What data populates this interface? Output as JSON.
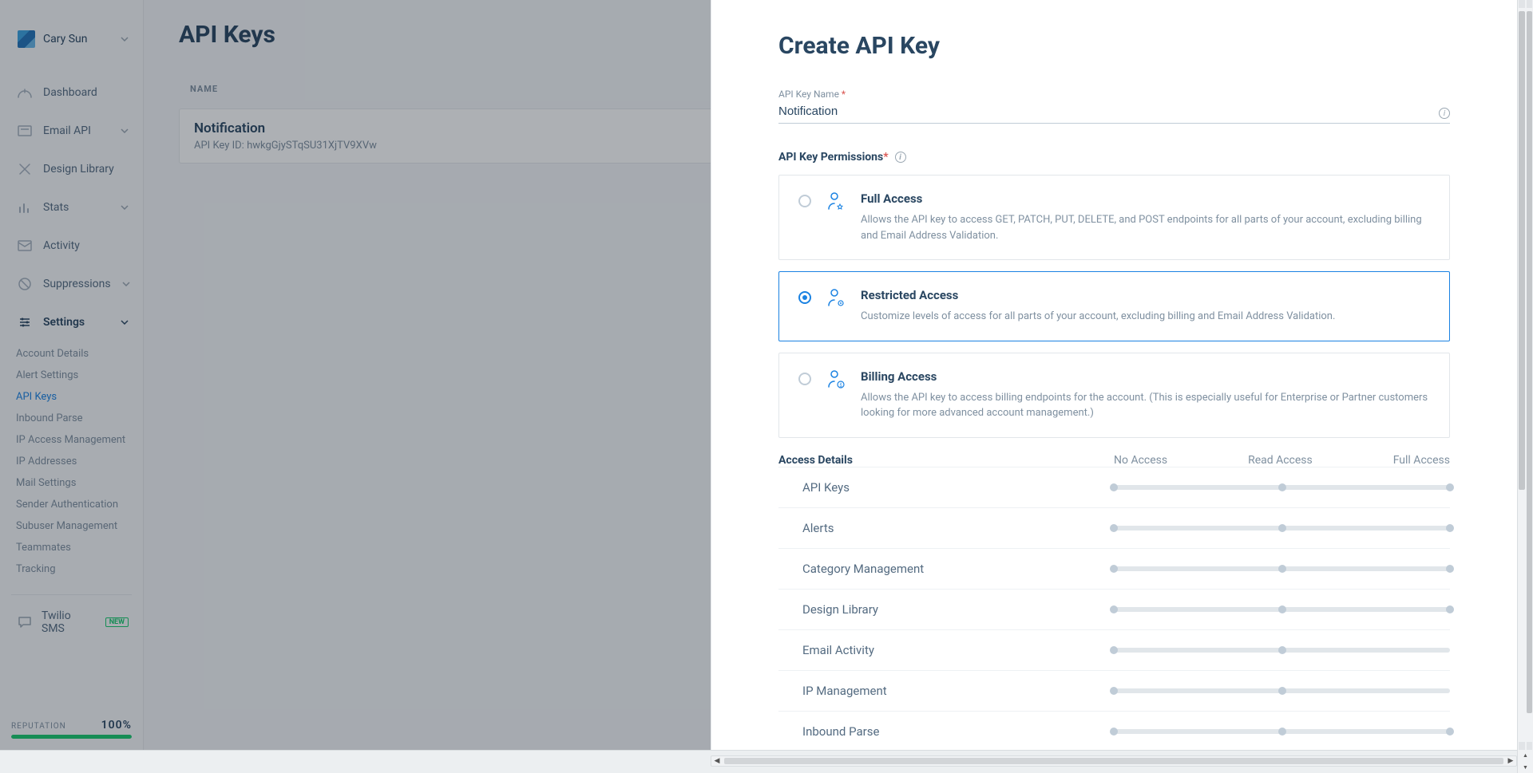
{
  "account": {
    "name": "Cary Sun"
  },
  "sidebar": {
    "items": [
      {
        "label": "Dashboard"
      },
      {
        "label": "Email API"
      },
      {
        "label": "Design Library"
      },
      {
        "label": "Stats"
      },
      {
        "label": "Activity"
      },
      {
        "label": "Suppressions"
      },
      {
        "label": "Settings"
      }
    ],
    "settings_sub": [
      {
        "label": "Account Details"
      },
      {
        "label": "Alert Settings"
      },
      {
        "label": "API Keys",
        "active": true
      },
      {
        "label": "Inbound Parse"
      },
      {
        "label": "IP Access Management"
      },
      {
        "label": "IP Addresses"
      },
      {
        "label": "Mail Settings"
      },
      {
        "label": "Sender Authentication"
      },
      {
        "label": "Subuser Management"
      },
      {
        "label": "Teammates"
      },
      {
        "label": "Tracking"
      }
    ],
    "twilio": {
      "label": "Twilio SMS",
      "badge": "NEW"
    },
    "reputation": {
      "label": "REPUTATION",
      "pct": "100%",
      "value": 100
    }
  },
  "page": {
    "title": "API Keys",
    "table_header": "NAME",
    "key": {
      "name": "Notification",
      "id_label": "API Key ID:",
      "id": "hwkgGjySTqSU31XjTV9XVw"
    }
  },
  "panel": {
    "title": "Create API Key",
    "name_label": "API Key Name",
    "name_value": "Notification",
    "perm_label": "API Key Permissions",
    "options": [
      {
        "title": "Full Access",
        "desc": "Allows the API key to access GET, PATCH, PUT, DELETE, and POST endpoints for all parts of your account, excluding billing and Email Address Validation."
      },
      {
        "title": "Restricted Access",
        "desc": "Customize levels of access for all parts of your account, excluding billing and Email Address Validation."
      },
      {
        "title": "Billing Access",
        "desc": "Allows the API key to access billing endpoints for the account. (This is especially useful for Enterprise or Partner customers looking for more advanced account management.)"
      }
    ],
    "access": {
      "label": "Access Details",
      "cols": [
        "No Access",
        "Read Access",
        "Full Access"
      ],
      "rows": [
        {
          "name": "API Keys",
          "stops": 3
        },
        {
          "name": "Alerts",
          "stops": 3
        },
        {
          "name": "Category Management",
          "stops": 3
        },
        {
          "name": "Design Library",
          "stops": 3
        },
        {
          "name": "Email Activity",
          "stops": 2
        },
        {
          "name": "IP Management",
          "stops": 2
        },
        {
          "name": "Inbound Parse",
          "stops": 3
        }
      ]
    }
  }
}
